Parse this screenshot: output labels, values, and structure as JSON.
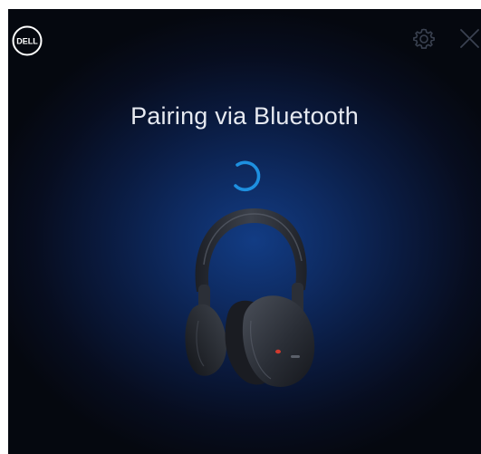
{
  "window": {
    "title": "Pairing via Bluetooth"
  },
  "header": {
    "logo_text": "DELL",
    "logo_icon": "dell-logo",
    "settings_icon": "gear-icon",
    "close_icon": "close-icon"
  },
  "status": {
    "spinner_icon": "loading-spinner-icon"
  },
  "device": {
    "image": "headphones-image"
  },
  "colors": {
    "background_center": "#123c84",
    "background_edge": "#05080f",
    "title_text": "#e6e9f0",
    "spinner_accent": "#1e90e0",
    "icon_muted": "#3a4150",
    "led_accent": "#d23a2e"
  }
}
